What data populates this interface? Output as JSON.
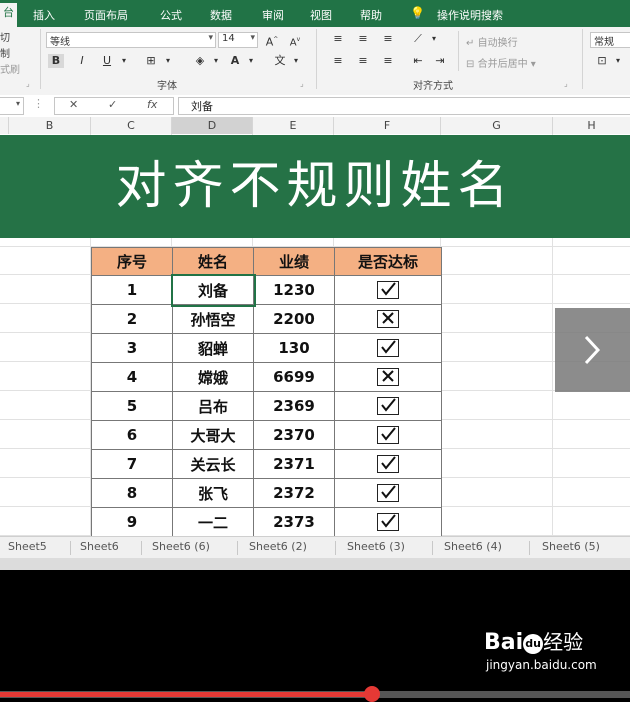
{
  "ribbon_tabs": [
    "台",
    "插入",
    "页面布局",
    "公式",
    "数据",
    "审阅",
    "视图",
    "帮助",
    "操作说明搜索"
  ],
  "ribbon": {
    "clipboard_items": [
      "切",
      "制",
      "式刷"
    ],
    "font_name": "等线",
    "font_size": "14",
    "font_group_label": "字体",
    "wrap_text": "自动换行",
    "merge_center": "合并后居中",
    "align_group_label": "对齐方式",
    "number_format": "常规",
    "bold": "B",
    "italic": "I",
    "underline": "U",
    "grow_font": "A",
    "shrink_font": "A",
    "font_color_btn": "A",
    "dropdown_icon": "chevron-down-icon"
  },
  "formula_bar": {
    "cancel": "✕",
    "enter": "✓",
    "fx": "fx",
    "content": "刘备"
  },
  "columns": [
    "B",
    "C",
    "D",
    "E",
    "F",
    "G",
    "H"
  ],
  "banner_title": "对齐不规则姓名",
  "table": {
    "headers": [
      "序号",
      "姓名",
      "业绩",
      "是否达标"
    ],
    "rows": [
      {
        "no": "1",
        "name": "刘备",
        "score": "1230",
        "ok": true
      },
      {
        "no": "2",
        "name": "孙悟空",
        "score": "2200",
        "ok": false
      },
      {
        "no": "3",
        "name": "貂蝉",
        "score": "130",
        "ok": true
      },
      {
        "no": "4",
        "name": "嫦娥",
        "score": "6699",
        "ok": false
      },
      {
        "no": "5",
        "name": "吕布",
        "score": "2369",
        "ok": true
      },
      {
        "no": "6",
        "name": "大哥大",
        "score": "2370",
        "ok": true
      },
      {
        "no": "7",
        "name": "关云长",
        "score": "2371",
        "ok": true
      },
      {
        "no": "8",
        "name": "张飞",
        "score": "2372",
        "ok": true
      },
      {
        "no": "9",
        "name": "一二",
        "score": "2373",
        "ok": true
      }
    ]
  },
  "next_button_icon": "chevron-right-icon",
  "sheet_tabs": [
    "Sheet5",
    "Sheet6",
    "Sheet6 (6)",
    "Sheet6 (2)",
    "Sheet6 (3)",
    "Sheet6 (4)",
    "Sheet6 (5)"
  ],
  "watermark": {
    "brand": "Bai",
    "brand2": "du",
    "suffix": "经验",
    "url": "jingyan.baidu.com"
  },
  "video_progress": 0.59,
  "colors": {
    "excel_green": "#217346",
    "banner_green": "#257246",
    "header_orange": "#f4b083",
    "progress_red": "#e53935"
  }
}
